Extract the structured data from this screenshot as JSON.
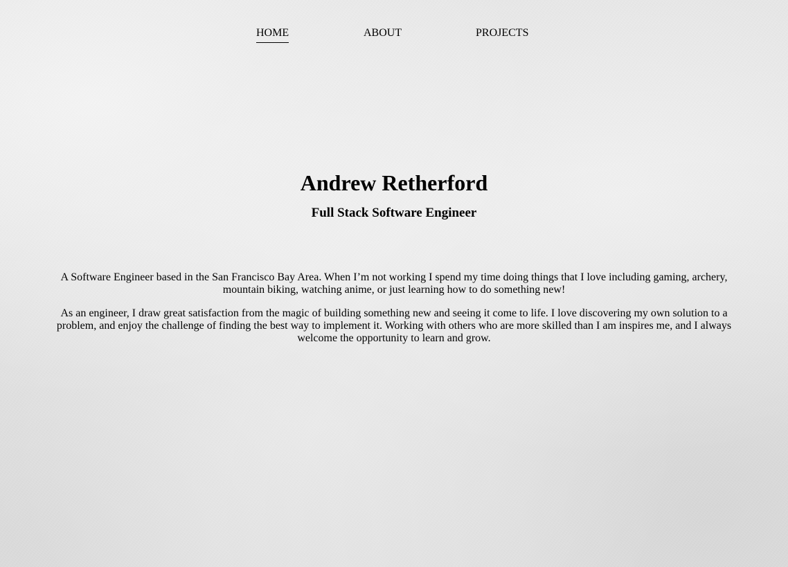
{
  "nav": {
    "items": [
      {
        "label": "HOME",
        "active": true
      },
      {
        "label": "ABOUT",
        "active": false
      },
      {
        "label": "PROJECTS",
        "active": false
      }
    ]
  },
  "hero": {
    "name": "Andrew Retherford",
    "title": "Full Stack Software Engineer"
  },
  "about": {
    "paragraphs": [
      "A Software Engineer based in the San Francisco Bay Area. When I’m not working I spend my time doing things that I love including gaming, archery, mountain biking, watching anime, or just learning how to do something new!",
      "As an engineer, I draw great satisfaction from the magic of building something new and seeing it come to life. I love discovering my own solution to a problem, and enjoy the challenge of finding the best way to implement it. Working with others who are more skilled than I am inspires me, and I always welcome the opportunity to learn and grow."
    ]
  }
}
